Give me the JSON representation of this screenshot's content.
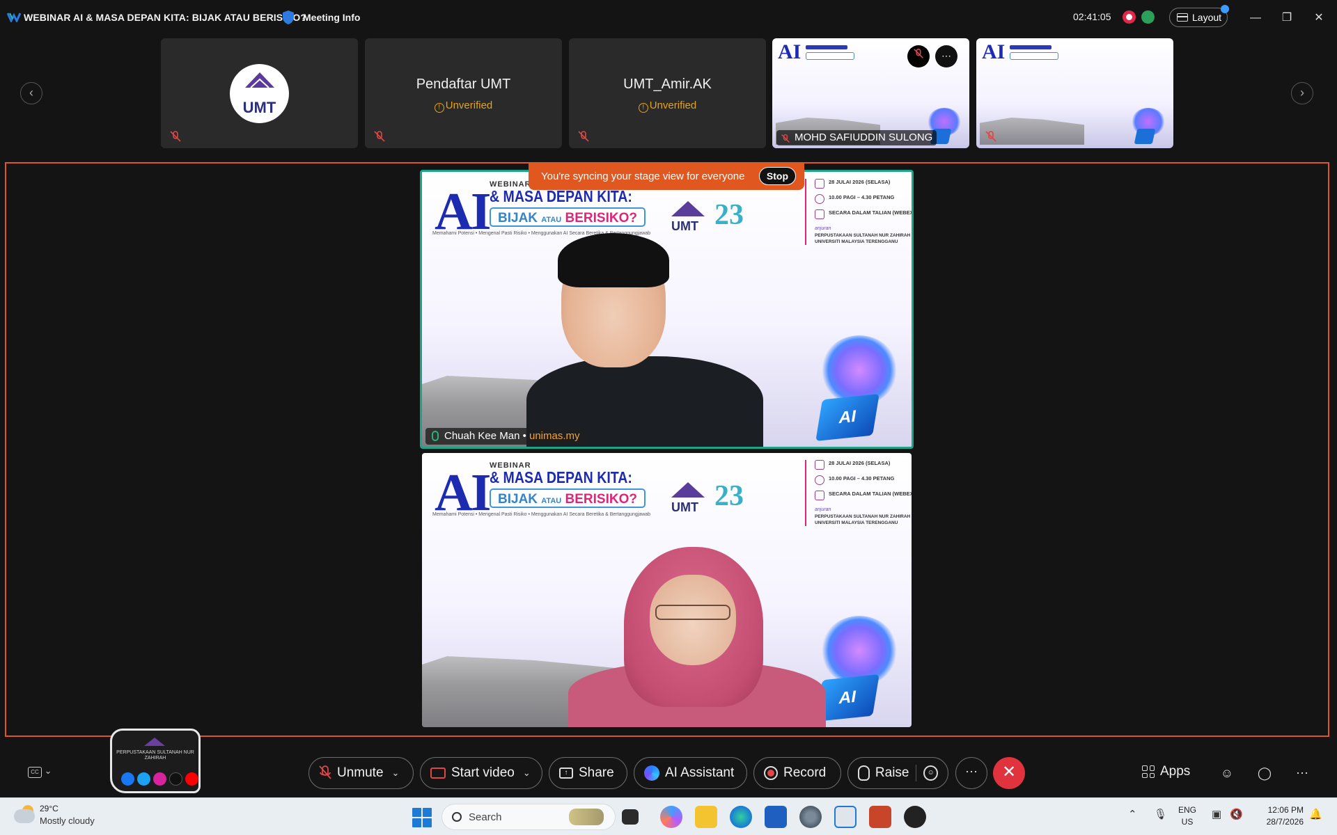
{
  "window": {
    "title": "WEBINAR AI & MASA DEPAN KITA: BIJAK ATAU BERISIKO?",
    "meeting_info": "Meeting Info",
    "timer": "02:41:05",
    "layout_label": "Layout"
  },
  "thumbnails": [
    {
      "name": "",
      "status": "",
      "type": "logo",
      "logo_text": "UMT"
    },
    {
      "name": "Pendaftar UMT",
      "status": "Unverified",
      "type": "avatar"
    },
    {
      "name": "UMT_Amir.AK",
      "status": "Unverified",
      "type": "avatar"
    },
    {
      "name": "MOHD SAFIUDDIN SULONG",
      "type": "slide"
    },
    {
      "name": "",
      "type": "slide"
    }
  ],
  "stage": {
    "banner_text": "You're syncing your stage view for everyone",
    "stop_label": "Stop",
    "slide": {
      "ai": "AI",
      "webinar": "WEBINAR",
      "heading": "& MASA DEPAN KITA:",
      "bijak": "BIJAK",
      "atau": "ATAU",
      "berisiko": "BERISIKO?",
      "tagline": "Memahami Potensi  •  Mengenal Pasti Risiko  •  Menggunakan AI Secara Beretika & Bertanggungjawab",
      "umt": "UMT",
      "anniv": "23",
      "date": "28 JULAI 2026 (SELASA)",
      "time": "10.00 PAGI – 4.30 PETANG",
      "mode": "SECARA DALAM TALIAN (WEBEX)",
      "anjuran": "anjuran",
      "organizer": "PERPUSTAKAAN SULTANAH NUR ZAHIRAH UNIVERSITI MALAYSIA TERENGGANU",
      "chip": "AI"
    },
    "speaker": {
      "name": "Chuah Kee Man",
      "org": "unimas.my"
    }
  },
  "toolbar": {
    "unmute": "Unmute",
    "start_video": "Start video",
    "share": "Share",
    "ai_assistant": "AI Assistant",
    "record": "Record",
    "raise": "Raise",
    "apps": "Apps",
    "library_name": "PERPUSTAKAAN SULTANAH NUR ZAHIRAH"
  },
  "taskbar": {
    "temperature": "29°C",
    "condition": "Mostly cloudy",
    "search_placeholder": "Search",
    "lang_1": "ENG",
    "lang_2": "US",
    "time": "12:06 PM",
    "date": "28/7/2026"
  },
  "colors": {
    "accent_orange": "#e0571f",
    "active_speaker": "#1aa589",
    "unverified": "#e6a21a",
    "leave_red": "#e0333d"
  }
}
